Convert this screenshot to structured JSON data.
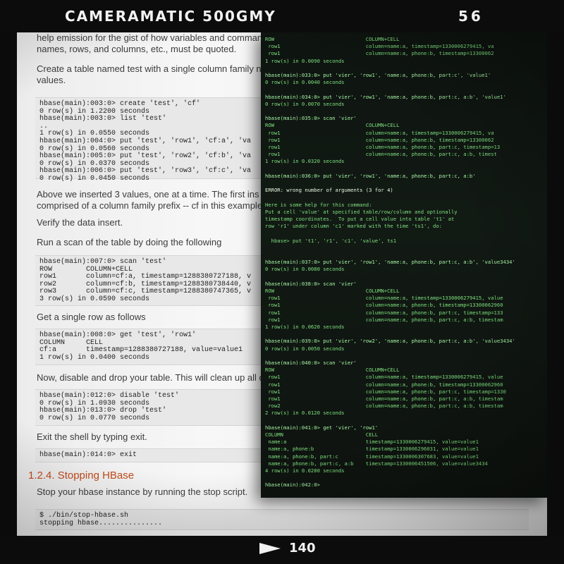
{
  "frame": {
    "title": "CAMERAMATIC 500GMY",
    "number": "56",
    "counter": "140"
  },
  "doc": {
    "intro_1": "help emission for the gist of how variables and command",
    "intro_2": "names, rows, and columns, etc., must be quoted.",
    "create_1": "Create a table named test with a single column family n",
    "create_2": "values.",
    "code1": "hbase(main):003:0> create 'test', 'cf'\n0 row(s) in 1.2200 seconds\nhbase(main):003:0> list 'test'\n..\n1 row(s) in 0.0550 seconds\nhbase(main):004:0> put 'test', 'row1', 'cf:a', 'va\n0 row(s) in 0.0560 seconds\nhbase(main):005:0> put 'test', 'row2', 'cf:b', 'va\n0 row(s) in 0.0370 seconds\nhbase(main):006:0> put 'test', 'row3', 'cf:c', 'va\n0 row(s) in 0.0450 seconds",
    "above_1": "Above we inserted 3 values, one at a time. The first ins",
    "above_2": "comprised of a column family prefix -- cf in this example",
    "verify": "Verify the data insert.",
    "run_scan": "Run a scan of the table by doing the following",
    "code2": "hbase(main):007:0> scan 'test'\nROW        COLUMN+CELL\nrow1       column=cf:a, timestamp=1288380727188, v\nrow2       column=cf:b, timestamp=1288380738440, v\nrow3       column=cf:c, timestamp=1288380747365, v\n3 row(s) in 0.0590 seconds",
    "get_row": "Get a single row as follows",
    "code3": "hbase(main):008:0> get 'test', 'row1'\nCOLUMN     CELL\ncf:a       timestamp=1288380727188, value=value1\n1 row(s) in 0.0400 seconds",
    "disable": "Now, disable and drop your table. This will clean up all do",
    "code4": "hbase(main):012:0> disable 'test'\n0 row(s) in 1.0930 seconds\nhbase(main):013:0> drop 'test'\n0 row(s) in 0.0770 seconds",
    "exit_shell": "Exit the shell by typing exit.",
    "code5": "hbase(main):014:0> exit",
    "heading": "1.2.4. Stopping HBase",
    "stop_text": "Stop your hbase instance by running the stop script.",
    "code6": "$ ./bin/stop-hbase.sh\nstopping hbase..............."
  },
  "terminal": [
    "ROW                              COLUMN+CELL",
    " row1                            column=name:a, timestamp=1330006279415, va",
    " row1                            column=name:a, phone:b, timestamp=13300062",
    "1 row(s) in 0.0090 seconds",
    "",
    "hbase(main):033:0> put 'vier', 'row1', 'name:a, phone:b, part:c', 'value1'",
    "0 row(s) in 0.0040 seconds",
    "",
    "hbase(main):034:0> put 'vier', 'row1', 'name:a, phone:b, part:c, a:b', 'value1'",
    "0 row(s) in 0.0070 seconds",
    "",
    "hbase(main):035:0> scan 'vier'",
    "ROW                              COLUMN+CELL",
    " row1                            column=name:a, timestamp=1330006279415, va",
    " row1                            column=name:a, phone:b, timestamp=13300062",
    " row1                            column=name:a, phone:b, part:c, timestamp=13",
    " row1                            column=name:a, phone:b, part:c, a:b, timest",
    "1 row(s) in 0.0320 seconds",
    "",
    "hbase(main):036:0> put 'vier', 'row1', 'name:a, phone:b, part:c, a:b'",
    "",
    "ERROR: wrong number of arguments (3 for 4)",
    "",
    "Here is some help for this command:",
    "Put a cell 'value' at specified table/row/column and optionally",
    "timestamp coordinates.  To put a cell value into table 't1' at",
    "row 'r1' under column 'c1' marked with the time 'ts1', do:",
    "",
    "  hbase> put 't1', 'r1', 'c1', 'value', ts1",
    "",
    "",
    "hbase(main):037:0> put 'vier', 'row1', 'name:a, phone:b, part:c, a:b', 'value3434'",
    "0 row(s) in 0.0080 seconds",
    "",
    "hbase(main):038:0> scan 'vier'",
    "ROW                              COLUMN+CELL",
    " row1                            column=name:a, timestamp=1330006279415, value",
    " row1                            column=name:a, phone:b, timestamp=13300062960",
    " row1                            column=name:a, phone:b, part:c, timestamp=133",
    " row1                            column=name:a, phone:b, part:c, a:b, timestam",
    "1 row(s) in 0.0620 seconds",
    "",
    "hbase(main):039:0> put 'vier', 'row2', 'name:a, phone:b, part:c, a:b', 'value3434'",
    "0 row(s) in 0.0050 seconds",
    "",
    "hbase(main):040:0> scan 'vier'",
    "ROW                              COLUMN+CELL",
    " row1                            column=name:a, timestamp=1330006279415, value",
    " row1                            column=name:a, phone:b, timestamp=13300062960",
    " row1                            column=name:a, phone:b, part:c, timestamp=1330",
    " row1                            column=name:a, phone:b, part:c, a:b, timestam",
    " row2                            column=name:a, phone:b, part:c, a:b, timestam",
    "2 row(s) in 0.0120 seconds",
    "",
    "hbase(main):041:0> get 'vier', 'row1'",
    "COLUMN                           CELL",
    " name:a                          timestamp=1330006279415, value=value1",
    " name:a, phone:b                 timestamp=1330006296031, value=value1",
    " name:a, phone:b, part:c         timestamp=1330006307683, value=value1",
    " name:a, phone:b, part:c, a:b    timestamp=1330006451506, value=value3434",
    "4 row(s) in 0.0280 seconds",
    "",
    "hbase(main):042:0>"
  ]
}
